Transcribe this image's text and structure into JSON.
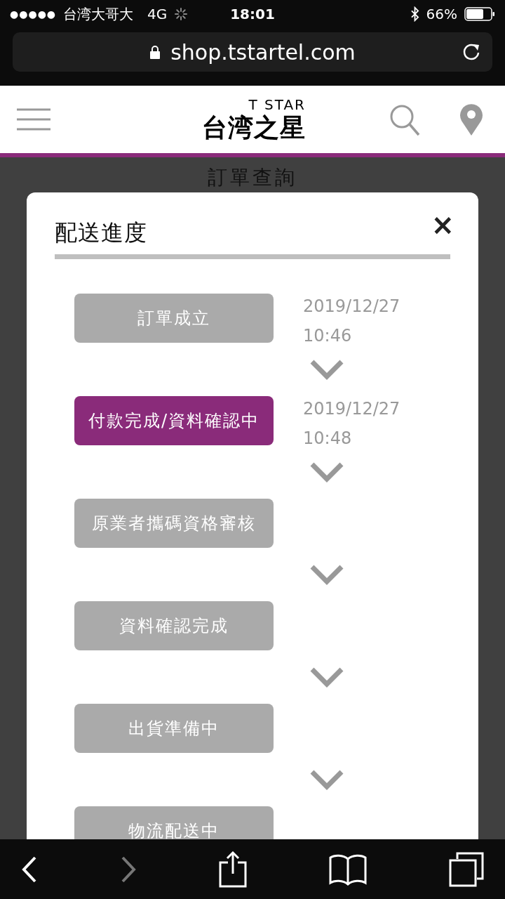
{
  "status_bar": {
    "signal": "●●●●●",
    "carrier": "台湾大哥大",
    "network": "4G",
    "time": "18:01",
    "battery": "66%"
  },
  "browser": {
    "url": "shop.tstartel.com"
  },
  "header": {
    "logo_top": "T STAR",
    "logo_main": "台湾之星"
  },
  "page": {
    "title": "訂單查詢"
  },
  "modal": {
    "title": "配送進度",
    "close": "×",
    "steps": [
      {
        "label": "訂單成立",
        "selected": false,
        "date": "2019/12/27",
        "time": "10:46"
      },
      {
        "label": "付款完成/資料確認中",
        "selected": true,
        "date": "2019/12/27",
        "time": "10:48"
      },
      {
        "label": "原業者攜碼資格審核",
        "selected": false
      },
      {
        "label": "資料確認完成",
        "selected": false
      },
      {
        "label": "出貨準備中",
        "selected": false
      },
      {
        "label": "物流配送中",
        "selected": false
      }
    ]
  }
}
